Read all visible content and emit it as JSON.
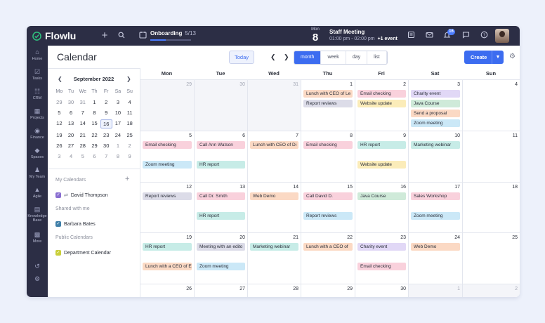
{
  "app": {
    "brand": "Flowlu"
  },
  "topbar": {
    "onboarding_label": "Onboarding",
    "onboarding_progress": "5/13",
    "onboarding_fraction": 0.38,
    "day_name": "Mon",
    "day_number": "8",
    "event_title": "Staff Meeting",
    "event_time": "01:00 pm - 02:00 pm",
    "event_more": "+1 event",
    "notification_count": "16"
  },
  "sidebar": {
    "items": [
      {
        "label": "Home",
        "icon": "home-icon"
      },
      {
        "label": "Tasks",
        "icon": "tasks-icon"
      },
      {
        "label": "CRM",
        "icon": "crm-icon"
      },
      {
        "label": "Projects",
        "icon": "projects-icon"
      },
      {
        "label": "Finance",
        "icon": "finance-icon"
      },
      {
        "label": "Spaces",
        "icon": "spaces-icon"
      },
      {
        "label": "My Team",
        "icon": "team-icon"
      },
      {
        "label": "Agile",
        "icon": "agile-icon"
      },
      {
        "label": "Knowledge Base",
        "icon": "knowledge-icon"
      },
      {
        "label": "More",
        "icon": "more-icon"
      }
    ]
  },
  "header": {
    "title": "Calendar",
    "today_label": "Today",
    "views": [
      "month",
      "week",
      "day",
      "list"
    ],
    "active_view": "month",
    "create_label": "Create"
  },
  "mini_calendar": {
    "title": "September 2022",
    "weekdays": [
      "Mo",
      "Tu",
      "We",
      "Th",
      "Fr",
      "Sa",
      "Su"
    ],
    "days": [
      [
        "29",
        "30",
        "31",
        "1",
        "2",
        "3",
        "4"
      ],
      [
        "5",
        "6",
        "7",
        "8",
        "9",
        "10",
        "11"
      ],
      [
        "12",
        "13",
        "14",
        "15",
        "16",
        "17",
        "18"
      ],
      [
        "19",
        "20",
        "21",
        "22",
        "23",
        "24",
        "25"
      ],
      [
        "26",
        "27",
        "28",
        "29",
        "30",
        "1",
        "2"
      ],
      [
        "3",
        "4",
        "5",
        "6",
        "7",
        "8",
        "9"
      ]
    ],
    "selected": "16"
  },
  "calendars": {
    "my_label": "My Calendars",
    "my_items": [
      {
        "name": "David Thompson",
        "color": "#8a6fd1"
      }
    ],
    "shared_label": "Shared with me",
    "shared_items": [
      {
        "name": "Barbara Bates",
        "color": "#3f7fa8"
      }
    ],
    "public_label": "Public Calendars",
    "public_items": [
      {
        "name": "Department Calendar",
        "color": "#c9cf3a"
      }
    ]
  },
  "month": {
    "weekdays": [
      "Mon",
      "Tue",
      "Wed",
      "Thu",
      "Fri",
      "Sat",
      "Sun"
    ],
    "weeks": [
      {
        "days": [
          {
            "n": "29",
            "other": true,
            "events": []
          },
          {
            "n": "30",
            "other": true,
            "events": []
          },
          {
            "n": "31",
            "other": true,
            "events": []
          },
          {
            "n": "1",
            "events": [
              {
                "t": "Lunch with CEO of Le",
                "c": "#fbd9c4",
                "slot": 0
              },
              {
                "t": "Report reviews",
                "c": "#dcdce8",
                "slot": 1
              }
            ]
          },
          {
            "n": "2",
            "events": [
              {
                "t": "Email checking",
                "c": "#f9d1dc",
                "slot": 0
              },
              {
                "t": "Website update",
                "c": "#fbecb9",
                "slot": 1
              }
            ]
          },
          {
            "n": "3",
            "events": [
              {
                "t": "Charity event",
                "c": "#e1d8f6",
                "slot": 0
              },
              {
                "t": "Java Course",
                "c": "#cfead9",
                "slot": 1
              },
              {
                "t": "Send a proposal",
                "c": "#fbd9c4",
                "slot": 2
              },
              {
                "t": "Zoom meeting",
                "c": "#cbe8f7",
                "slot": 3
              }
            ]
          },
          {
            "n": "4",
            "events": []
          }
        ]
      },
      {
        "days": [
          {
            "n": "5",
            "events": [
              {
                "t": "Email checking",
                "c": "#f9d1dc",
                "slot": 0
              },
              {
                "t": "Zoom meeting",
                "c": "#cbe8f7",
                "slot": 2
              }
            ]
          },
          {
            "n": "6",
            "events": [
              {
                "t": "Call Ann Watson",
                "c": "#f9d1dc",
                "slot": 0
              },
              {
                "t": "HR report",
                "c": "#c7ece7",
                "slot": 2
              }
            ]
          },
          {
            "n": "7",
            "events": [
              {
                "t": "Lunch with CEO of Di",
                "c": "#fbd9c4",
                "slot": 0
              }
            ]
          },
          {
            "n": "8",
            "events": [
              {
                "t": "Email checking",
                "c": "#f9d1dc",
                "slot": 0
              }
            ]
          },
          {
            "n": "9",
            "events": [
              {
                "t": "HR report",
                "c": "#c7ece7",
                "slot": 0
              },
              {
                "t": "Website update",
                "c": "#fbecb9",
                "slot": 2
              }
            ]
          },
          {
            "n": "10",
            "events": [
              {
                "t": "Marketing webinar",
                "c": "#c7ece7",
                "slot": 0
              }
            ]
          },
          {
            "n": "11",
            "events": []
          }
        ]
      },
      {
        "days": [
          {
            "n": "12",
            "events": [
              {
                "t": "Report reviews",
                "c": "#dcdce8",
                "slot": 0
              }
            ]
          },
          {
            "n": "13",
            "events": [
              {
                "t": "Call Dr. Smith",
                "c": "#f9d1dc",
                "slot": 0
              },
              {
                "t": "HR report",
                "c": "#c7ece7",
                "slot": 2
              }
            ]
          },
          {
            "n": "14",
            "events": [
              {
                "t": "Web Demo",
                "c": "#fbd9c4",
                "slot": 0
              }
            ]
          },
          {
            "n": "15",
            "events": [
              {
                "t": "Call David D.",
                "c": "#f9d1dc",
                "slot": 0
              },
              {
                "t": "Report reviews",
                "c": "#cbe8f7",
                "slot": 2
              }
            ]
          },
          {
            "n": "16",
            "events": [
              {
                "t": "Java Course",
                "c": "#cfead9",
                "slot": 0
              }
            ]
          },
          {
            "n": "17",
            "events": [
              {
                "t": "Sales Workshop",
                "c": "#f9d1dc",
                "slot": 0
              },
              {
                "t": "Zoom meeting",
                "c": "#cbe8f7",
                "slot": 2
              }
            ]
          },
          {
            "n": "18",
            "events": []
          }
        ]
      },
      {
        "days": [
          {
            "n": "19",
            "events": [
              {
                "t": "HR report",
                "c": "#c7ece7",
                "slot": 0
              },
              {
                "t": "Lunch with a CEO of E",
                "c": "#fbd9c4",
                "slot": 2
              }
            ]
          },
          {
            "n": "20",
            "events": [
              {
                "t": "Meeting with an edito",
                "c": "#dcdce8",
                "slot": 0
              },
              {
                "t": "Zoom meeting",
                "c": "#cbe8f7",
                "slot": 2
              }
            ]
          },
          {
            "n": "21",
            "events": [
              {
                "t": "Marketing webinar",
                "c": "#c7ece7",
                "slot": 0
              }
            ]
          },
          {
            "n": "22",
            "events": [
              {
                "t": "Lunch with a CEO of",
                "c": "#fbd9c4",
                "slot": 0
              }
            ]
          },
          {
            "n": "23",
            "events": [
              {
                "t": "Charity event",
                "c": "#e1d8f6",
                "slot": 0
              },
              {
                "t": "Email checking",
                "c": "#f9d1dc",
                "slot": 2
              }
            ]
          },
          {
            "n": "24",
            "events": [
              {
                "t": "Web Demo",
                "c": "#fbd9c4",
                "slot": 0
              }
            ]
          },
          {
            "n": "25",
            "events": []
          }
        ]
      },
      {
        "days": [
          {
            "n": "26",
            "events": []
          },
          {
            "n": "27",
            "events": []
          },
          {
            "n": "28",
            "events": []
          },
          {
            "n": "29",
            "events": []
          },
          {
            "n": "30",
            "events": []
          },
          {
            "n": "1",
            "other": true,
            "events": []
          },
          {
            "n": "2",
            "other": true,
            "events": []
          }
        ]
      }
    ]
  }
}
